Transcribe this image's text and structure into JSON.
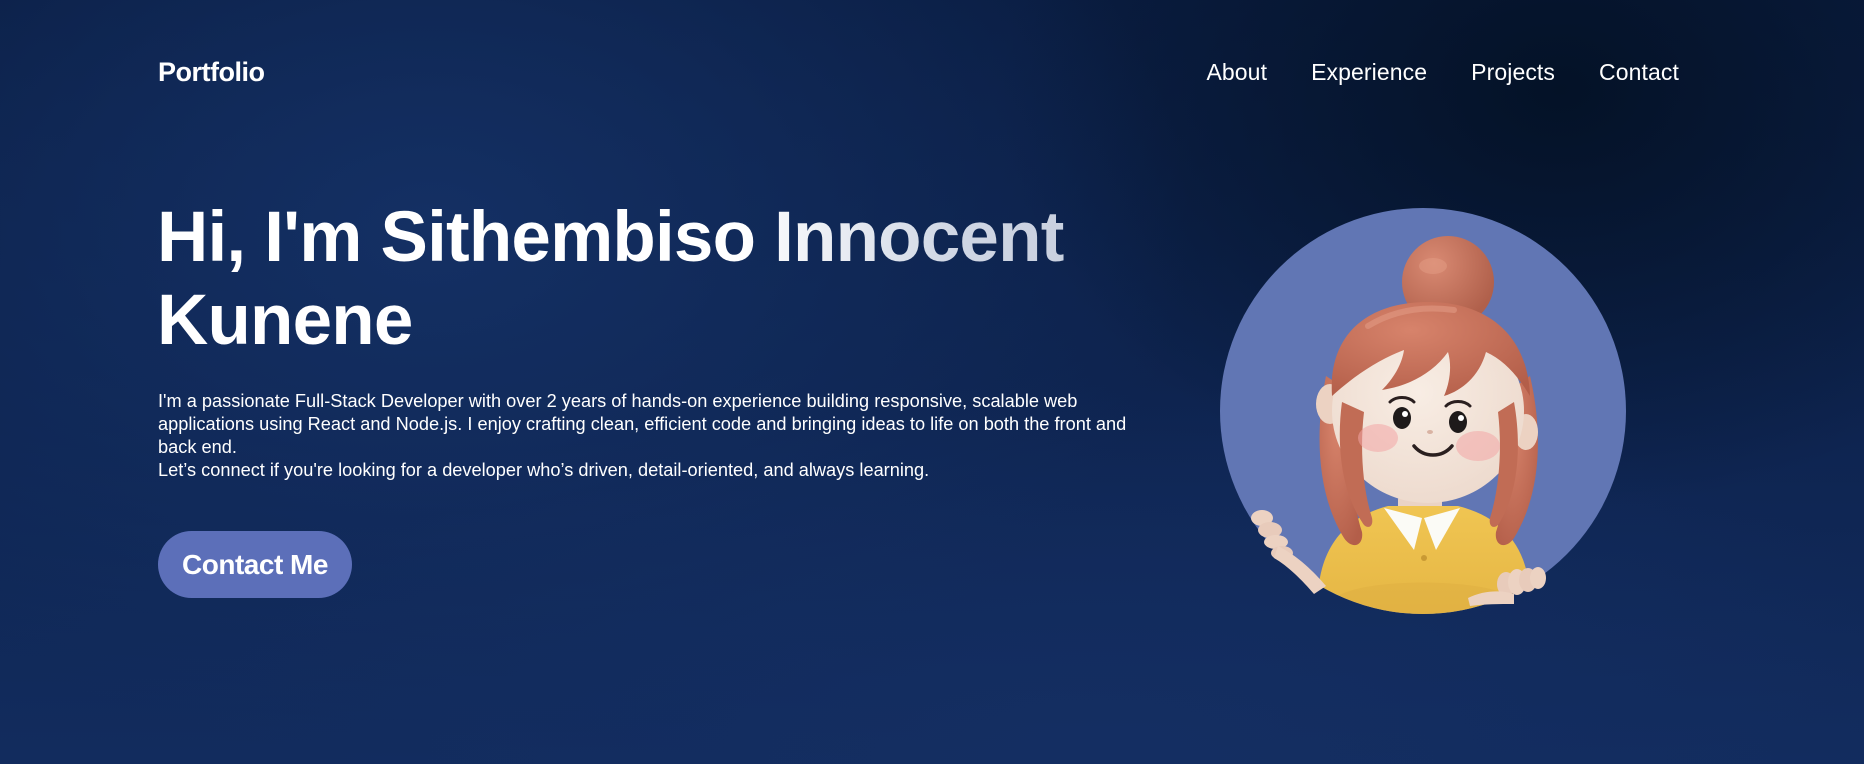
{
  "nav": {
    "brand": "Portfolio",
    "links": [
      {
        "label": "About"
      },
      {
        "label": "Experience"
      },
      {
        "label": "Projects"
      },
      {
        "label": "Contact"
      }
    ]
  },
  "hero": {
    "title": "Hi, I'm Sithembiso Innocent Kunene",
    "description_lines": [
      "I'm a passionate Full-Stack Developer with over 2 years of hands-on experience building responsive, scalable web applications using React and Node.js. I enjoy crafting clean, efficient code and bringing ideas to life on both the front and back end.",
      "Let’s connect if you're looking for a developer who’s driven, detail-oriented, and always learning."
    ],
    "cta_label": "Contact Me"
  },
  "avatar": {
    "icon": "cartoon-girl-avatar"
  },
  "colors": {
    "background": "#0e2450",
    "accent": "#5c6fb9",
    "avatar_circle": "#6176b4",
    "text": "#ffffff"
  }
}
